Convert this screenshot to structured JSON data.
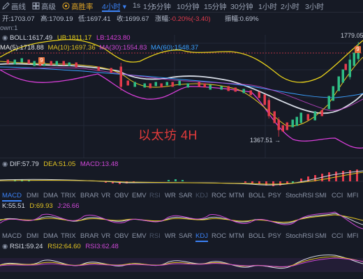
{
  "toolbar": {
    "items": [
      {
        "label": "画线",
        "icon": "pencil-icon"
      },
      {
        "label": "高级",
        "icon": "grid-icon"
      },
      {
        "label": "高胜率",
        "icon": "lightbulb-icon"
      }
    ],
    "timeframes": [
      "4小时",
      "1s",
      "1分",
      "5分钟",
      "10分钟",
      "15分钟",
      "30分钟",
      "1小时",
      "2小时",
      "3小时"
    ],
    "active_timeframe": "4小时",
    "active_color": "#3b82f6"
  },
  "ohlc": {
    "open_label": "开:",
    "open": "1703.07",
    "high_label": "高:",
    "high": "1709.19",
    "low_label": "低:",
    "low": "1697.41",
    "close_label": "收:",
    "close": "1699.67",
    "change_label": "涨幅:",
    "change": "-0.20%(-3.40)",
    "amplitude_label": "振幅:",
    "amplitude": "0.69%"
  },
  "indicator_row": {
    "text": "own:1"
  },
  "boll": {
    "boll": "BOLL:1617.49",
    "ub": "UB:1811.17",
    "lb": "LB:1423.80"
  },
  "ma": {
    "ma5": "MA(5):1718.88",
    "ma10": "MA(10):1697.36",
    "ma30": "MA(30):1554.83",
    "ma60": "MA(60):1548.37"
  },
  "chart_annotations": {
    "high_price": "1779.05",
    "low_price": "1367.51 →",
    "watermark": "以太坊 4H",
    "badge1": "9",
    "badge2": "9"
  },
  "macd": {
    "dif": "DIF:57.79",
    "dea": "DEA:51.05",
    "macd": "MACD:13.48"
  },
  "indicator_tabs_1": [
    "MACD",
    "DMI",
    "DMA",
    "TRIX",
    "BRAR",
    "VR",
    "OBV",
    "EMV",
    "RSI",
    "WR",
    "SAR",
    "KDJ",
    "ROC",
    "MTM",
    "BOLL",
    "PSY",
    "StochRSI",
    "SMI",
    "CCI",
    "MFI"
  ],
  "active_tab_1": "MACD",
  "kdj": {
    "k": "K:55.51",
    "d": "D:69.93",
    "j": "J:26.66"
  },
  "indicator_tabs_2": [
    "MACD",
    "DMI",
    "DMA",
    "TRIX",
    "BRAR",
    "VR",
    "OBV",
    "EMV",
    "RSI",
    "WR",
    "SAR",
    "KDJ",
    "ROC",
    "MTM",
    "BOLL",
    "PSY",
    "StochRSI",
    "SMI",
    "CCI",
    "MFI"
  ],
  "active_tab_2": "KDJ",
  "rsi": {
    "rsi1": "RSI1:59.24",
    "rsi2": "RSI2:64.60",
    "rsi3": "RSI3:62.48"
  },
  "colors": {
    "background": "#161a25",
    "up": "#2ebd85",
    "down": "#e33b4d",
    "boll_mid": "#d7dce6",
    "boll_upper": "#e9d21b",
    "boll_lower": "#d83fd9",
    "ma5": "#e8e8e8",
    "ma10": "#e3c423",
    "ma30": "#cf48d8",
    "ma60": "#3aa0ff"
  }
}
